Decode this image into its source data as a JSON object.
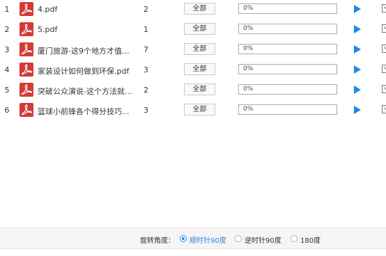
{
  "files": [
    {
      "index": "1",
      "name": "4.pdf",
      "pages": "2",
      "scope": "全部",
      "progress": "0%",
      "progress_value": 0
    },
    {
      "index": "2",
      "name": "5.pdf",
      "pages": "1",
      "scope": "全部",
      "progress": "0%",
      "progress_value": 0
    },
    {
      "index": "3",
      "name": "厦门旅游-这9个地方才值...",
      "pages": "7",
      "scope": "全部",
      "progress": "0%",
      "progress_value": 0
    },
    {
      "index": "4",
      "name": "家装设计如何做到环保.pdf",
      "pages": "3",
      "scope": "全部",
      "progress": "0%",
      "progress_value": 0
    },
    {
      "index": "5",
      "name": "突破公众演说-这个方法就...",
      "pages": "2",
      "scope": "全部",
      "progress": "0%",
      "progress_value": 0
    },
    {
      "index": "6",
      "name": "篮球小前锋各个得分技巧...",
      "pages": "3",
      "scope": "全部",
      "progress": "0%",
      "progress_value": 0
    }
  ],
  "rotation": {
    "label": "旋转角度：",
    "options": [
      {
        "label": "顺时针90度",
        "selected": true
      },
      {
        "label": "逆时针90度",
        "selected": false
      },
      {
        "label": "180度",
        "selected": false
      }
    ]
  },
  "colors": {
    "accent": "#1f88e6",
    "pdf_icon": "#d33a36"
  }
}
